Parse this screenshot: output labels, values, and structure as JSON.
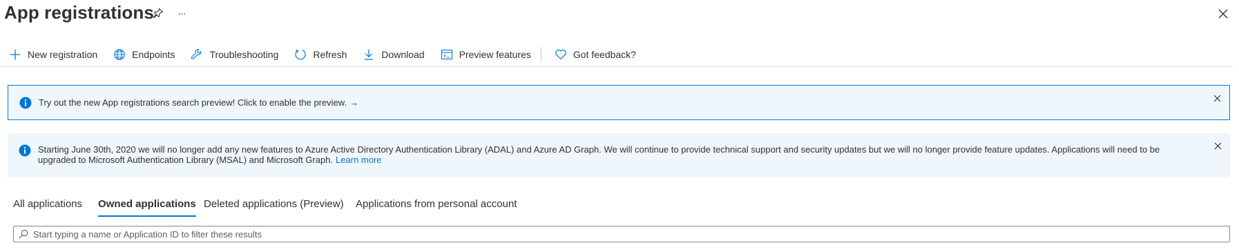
{
  "header": {
    "title": "App registrations",
    "pin_icon": "pin-icon",
    "more_icon": "more-icon",
    "more_glyph": "···",
    "close_icon": "close-icon"
  },
  "toolbar": {
    "items": [
      {
        "label": "New registration",
        "icon": "plus-icon"
      },
      {
        "label": "Endpoints",
        "icon": "globe-icon"
      },
      {
        "label": "Troubleshooting",
        "icon": "wrench-icon"
      },
      {
        "label": "Refresh",
        "icon": "refresh-icon"
      },
      {
        "label": "Download",
        "icon": "download-icon"
      },
      {
        "label": "Preview features",
        "icon": "preview-features-icon"
      },
      {
        "label": "Got feedback?",
        "icon": "heart-icon"
      }
    ]
  },
  "banners": {
    "preview": {
      "text": "Try out the new App registrations search preview! Click to enable the preview.",
      "arrow": "→"
    },
    "adal": {
      "text": "Starting June 30th, 2020 we will no longer add any new features to Azure Active Directory Authentication Library (ADAL) and Azure AD Graph. We will continue to provide technical support and security updates but we will no longer provide feature updates. Applications will need to be upgraded to Microsoft Authentication Library (MSAL) and Microsoft Graph.",
      "link": "Learn more"
    }
  },
  "tabs": [
    {
      "label": "All applications",
      "active": false
    },
    {
      "label": "Owned applications",
      "active": true
    },
    {
      "label": "Deleted applications (Preview)",
      "active": false
    },
    {
      "label": "Applications from personal account",
      "active": false
    }
  ],
  "search": {
    "placeholder": "Start typing a name or Application ID to filter these results",
    "value": ""
  },
  "colors": {
    "accent": "#0078d4",
    "banner_bg": "#eff6fc",
    "text": "#323130"
  }
}
